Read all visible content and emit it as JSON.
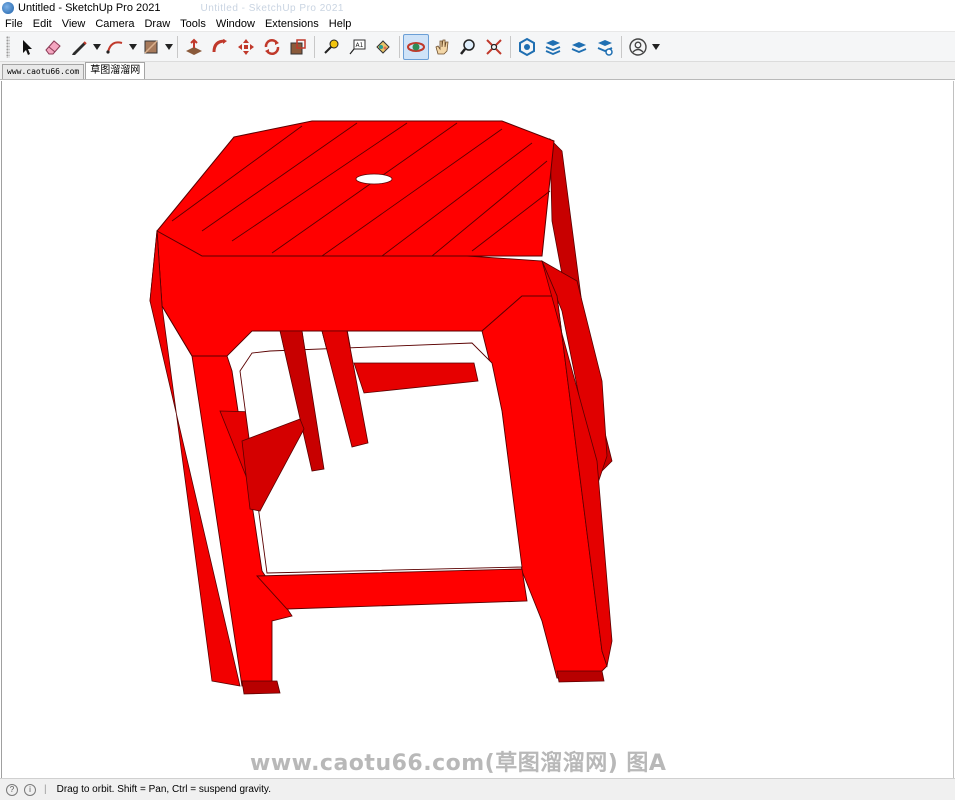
{
  "window": {
    "title": "Untitled - SketchUp Pro 2021",
    "ghost_title": "Untitled - SketchUp Pro 2021"
  },
  "menu": [
    "File",
    "Edit",
    "View",
    "Camera",
    "Draw",
    "Tools",
    "Window",
    "Extensions",
    "Help"
  ],
  "toolbar": {
    "tools": [
      {
        "name": "select-tool",
        "icon": "arrow-cursor-icon"
      },
      {
        "name": "eraser-tool",
        "icon": "eraser-icon"
      },
      {
        "name": "line-tool",
        "icon": "pencil-icon"
      },
      {
        "name": "arc-tool",
        "icon": "arc-icon"
      },
      {
        "name": "rectangle-tool",
        "icon": "rectangle-icon"
      },
      {
        "name": "push-pull-tool",
        "icon": "push-pull-icon"
      },
      {
        "name": "follow-me-tool",
        "icon": "follow-me-icon"
      },
      {
        "name": "move-tool",
        "icon": "move-icon"
      },
      {
        "name": "rotate-tool",
        "icon": "rotate-icon"
      },
      {
        "name": "scale-tool",
        "icon": "scale-icon"
      },
      {
        "name": "tape-measure-tool",
        "icon": "tape-measure-icon"
      },
      {
        "name": "text-tool",
        "icon": "text-icon"
      },
      {
        "name": "paint-bucket-tool",
        "icon": "paint-bucket-icon"
      },
      {
        "name": "orbit-tool",
        "icon": "orbit-icon"
      },
      {
        "name": "pan-tool",
        "icon": "hand-icon"
      },
      {
        "name": "zoom-tool",
        "icon": "magnifier-icon"
      },
      {
        "name": "zoom-extents-tool",
        "icon": "zoom-extents-icon"
      },
      {
        "name": "warehouse-tool",
        "icon": "3d-warehouse-icon"
      },
      {
        "name": "extension-warehouse-tool",
        "icon": "extension-warehouse-icon"
      },
      {
        "name": "layout-tool",
        "icon": "layout-icon"
      },
      {
        "name": "extension-manager-tool",
        "icon": "extension-manager-icon"
      },
      {
        "name": "account-tool",
        "icon": "user-icon"
      }
    ],
    "active_tool": "orbit-tool"
  },
  "tabs": [
    {
      "label": "www.caotu66.com",
      "active": false
    },
    {
      "label": "草图溜溜网",
      "active": true
    }
  ],
  "model": {
    "description_color": "#ff0000",
    "edge_color": "#5a0000"
  },
  "watermark": "www.caotu66.com(草图溜溜网) 图A",
  "status": {
    "hint": "Drag to orbit. Shift = Pan, Ctrl = suspend gravity."
  },
  "colors": {
    "model_red": "#ff0000",
    "model_shadow_red": "#c80000",
    "active_tool_bg": "#cfe3f8",
    "toolbar_bg": "#f5f6f7"
  }
}
